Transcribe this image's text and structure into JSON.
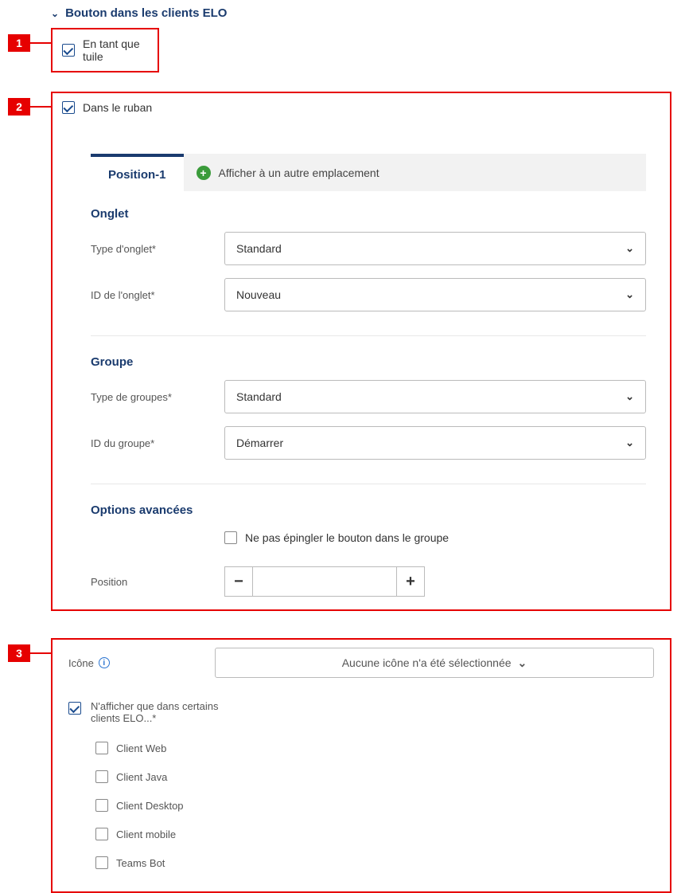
{
  "section_header": "Bouton dans les clients ELO",
  "callouts": {
    "n1": "1",
    "n2": "2",
    "n3": "3"
  },
  "check1": {
    "label": "En tant que tuile"
  },
  "check2": {
    "label": "Dans le ruban"
  },
  "tabs": {
    "active": "Position-1",
    "add": "Afficher à un autre emplacement"
  },
  "onglet": {
    "heading": "Onglet",
    "type_label": "Type d'onglet*",
    "type_value": "Standard",
    "id_label": "ID de l'onglet*",
    "id_value": "Nouveau"
  },
  "groupe": {
    "heading": "Groupe",
    "type_label": "Type de groupes*",
    "type_value": "Standard",
    "id_label": "ID du groupe*",
    "id_value": "Démarrer"
  },
  "advanced": {
    "heading": "Options avancées",
    "nopin_label": "Ne pas épingler le bouton dans le groupe",
    "position_label": "Position",
    "position_value": ""
  },
  "icon": {
    "label": "Icône",
    "select_text": "Aucune icône n'a été sélectionnée"
  },
  "show_only": {
    "label": "N'afficher que dans certains clients ELO...*"
  },
  "clients": {
    "c1": "Client Web",
    "c2": "Client Java",
    "c3": "Client Desktop",
    "c4": "Client mobile",
    "c5": "Teams Bot"
  }
}
